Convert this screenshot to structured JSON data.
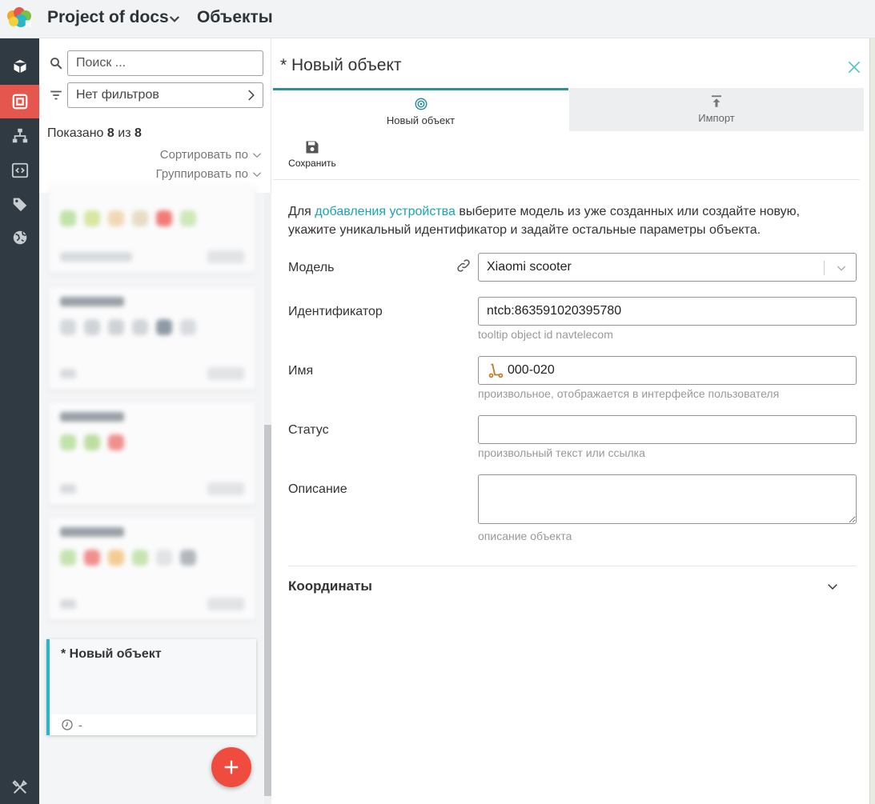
{
  "header": {
    "project_title": "Project of docs",
    "page_title": "Объекты"
  },
  "rail": {
    "icons": [
      "cube-icon",
      "objects-icon",
      "hierarchy-icon",
      "code-icon",
      "tag-icon",
      "globe-icon",
      "tools-icon"
    ],
    "active": "objects-icon",
    "active_color": "#e4564e"
  },
  "list": {
    "search_placeholder": "Поиск ...",
    "filter_text": "Нет фильтров",
    "shown_prefix": "Показано",
    "shown_count": "8",
    "shown_of": "из",
    "shown_total": "8",
    "sort_label": "Сортировать по",
    "group_label": "Группировать по",
    "new_card": {
      "title": "* Новый объект",
      "time": "-"
    },
    "accent_color": "#29b6c9",
    "fab_color": "#ef4b3f"
  },
  "editor": {
    "title": "* Новый объект",
    "tabs": [
      {
        "label": "Новый объект",
        "icon": "target-icon",
        "active": true
      },
      {
        "label": "Импорт",
        "icon": "upload-icon",
        "active": false
      }
    ],
    "save_label": "Сохранить",
    "intro_before": "Для ",
    "intro_link": "добавления устройства",
    "intro_after": " выберите модель из уже созданных или создайте новую, укажите уникальный идентификатор и задайте остальные параметры объекта.",
    "fields": {
      "model": {
        "label": "Модель",
        "value": "Xiaomi scooter"
      },
      "identifier": {
        "label": "Идентификатор",
        "value": "ntcb:863591020395780",
        "hint": "tooltip object id navtelecom"
      },
      "name": {
        "label": "Имя",
        "value": "000-020",
        "hint": "произвольное, отображается в интерфейсе пользователя"
      },
      "status": {
        "label": "Статус",
        "value": "",
        "hint": "произвольный текст или ссылка"
      },
      "description": {
        "label": "Описание",
        "value": "",
        "hint": "описание объекта"
      }
    },
    "coordinates_label": "Координаты",
    "link_color": "#1aa3b8"
  }
}
